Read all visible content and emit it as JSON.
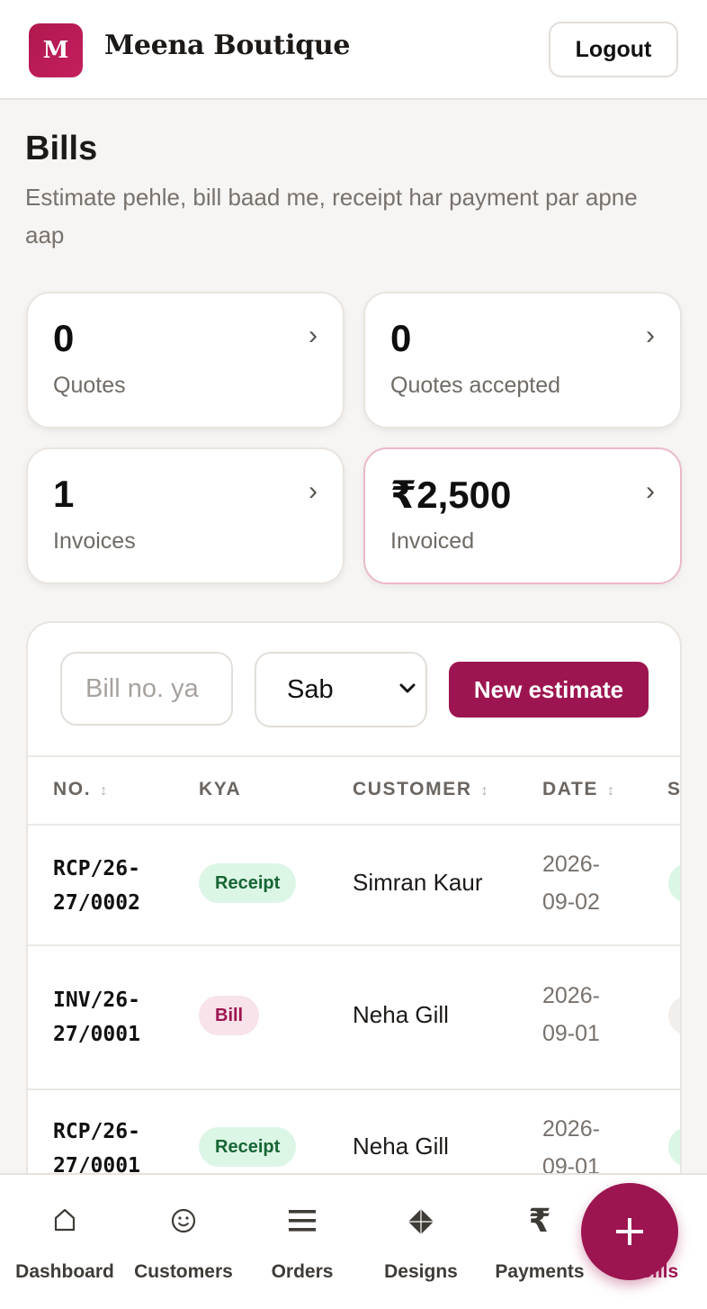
{
  "app": {
    "logo_letter": "M",
    "name": "Meena Boutique",
    "logout_label": "Logout"
  },
  "page": {
    "title": "Bills",
    "subtitle": "Estimate pehle, bill baad me, receipt har payment par apne aap"
  },
  "stats": [
    {
      "value": "0",
      "label": "Quotes"
    },
    {
      "value": "0",
      "label": "Quotes accepted"
    },
    {
      "value": "1",
      "label": "Invoices"
    },
    {
      "value": "₹2,500",
      "label": "Invoiced"
    }
  ],
  "filters": {
    "search_placeholder": "Bill no. ya",
    "type_selected": "Sab",
    "new_estimate_label": "New estimate"
  },
  "table": {
    "columns": [
      {
        "label": "NO.",
        "sortable": true
      },
      {
        "label": "KYA",
        "sortable": false
      },
      {
        "label": "CUSTOMER",
        "sortable": true
      },
      {
        "label": "DATE",
        "sortable": true
      },
      {
        "label": "S",
        "sortable": false
      }
    ],
    "rows": [
      {
        "no": "RCP/26-27/0002",
        "kind": "Receipt",
        "customer": "Simran Kaur",
        "date": "2026-09-02"
      },
      {
        "no": "INV/26-27/0001",
        "kind": "Bill",
        "customer": "Neha Gill",
        "date": "2026-09-01"
      },
      {
        "no": "RCP/26-27/0001",
        "kind": "Receipt",
        "customer": "Neha Gill",
        "date": "2026-09-01"
      }
    ]
  },
  "nav": [
    {
      "label": "Dashboard",
      "icon": "home-icon"
    },
    {
      "label": "Customers",
      "icon": "smiley-icon"
    },
    {
      "label": "Orders",
      "icon": "list-icon"
    },
    {
      "label": "Designs",
      "icon": "diamond-icon"
    },
    {
      "label": "Payments",
      "icon": "rupee-icon"
    },
    {
      "label": "Bills",
      "icon": "bill-icon",
      "active": true
    }
  ],
  "colors": {
    "accent": "#9d1550",
    "receipt_bg": "#dcf6e6",
    "receipt_text": "#166534",
    "bill_bg": "#f8e3ea"
  }
}
